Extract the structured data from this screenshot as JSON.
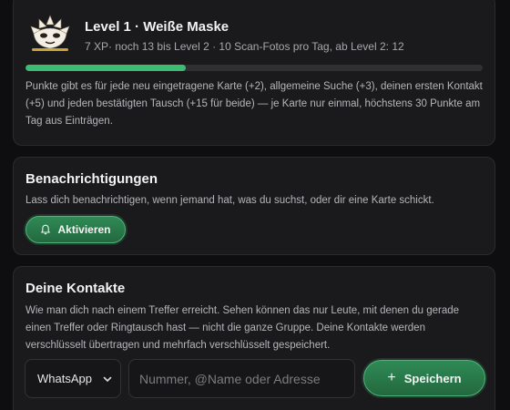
{
  "level": {
    "title": "Level 1 · Weiße Maske",
    "subtitle": "7 XP· noch 13 bis Level 2 · 10 Scan-Fotos pro Tag, ab Level 2: 12",
    "progress_percent": 35,
    "description": "Punkte gibt es für jede neu eingetragene Karte (+2), allgemeine Suche (+3), deinen ersten Kontakt (+5) und jeden bestätigten Tausch (+15 für beide) — je Karte nur einmal, höchstens 30 Punkte am Tag aus Einträgen.",
    "logo_icon": "white-mask-icon"
  },
  "notifications": {
    "heading": "Benachrichtigungen",
    "text": "Lass dich benachrichtigen, wenn jemand hat, was du suchst, oder dir eine Karte schickt.",
    "activate_label": "Aktivieren",
    "activate_icon": "bell-icon"
  },
  "contacts": {
    "heading": "Deine Kontakte",
    "text": "Wie man dich nach einem Treffer erreicht. Sehen können das nur Leute, mit denen du gerade einen Treffer oder Ringtausch hast — nicht die ganze Gruppe. Deine Kontakte werden verschlüsselt übertragen und mehrfach verschlüsselt gespeichert.",
    "channel_selected": "WhatsApp",
    "input_value": "",
    "input_placeholder": "Nummer, @Name oder Adresse",
    "save_label": "Speichern"
  },
  "colors": {
    "accent_green": "#3dbb72",
    "button_green": "#2f8a55",
    "card_bg": "#1a1a1c",
    "page_bg": "#0e0e10"
  }
}
